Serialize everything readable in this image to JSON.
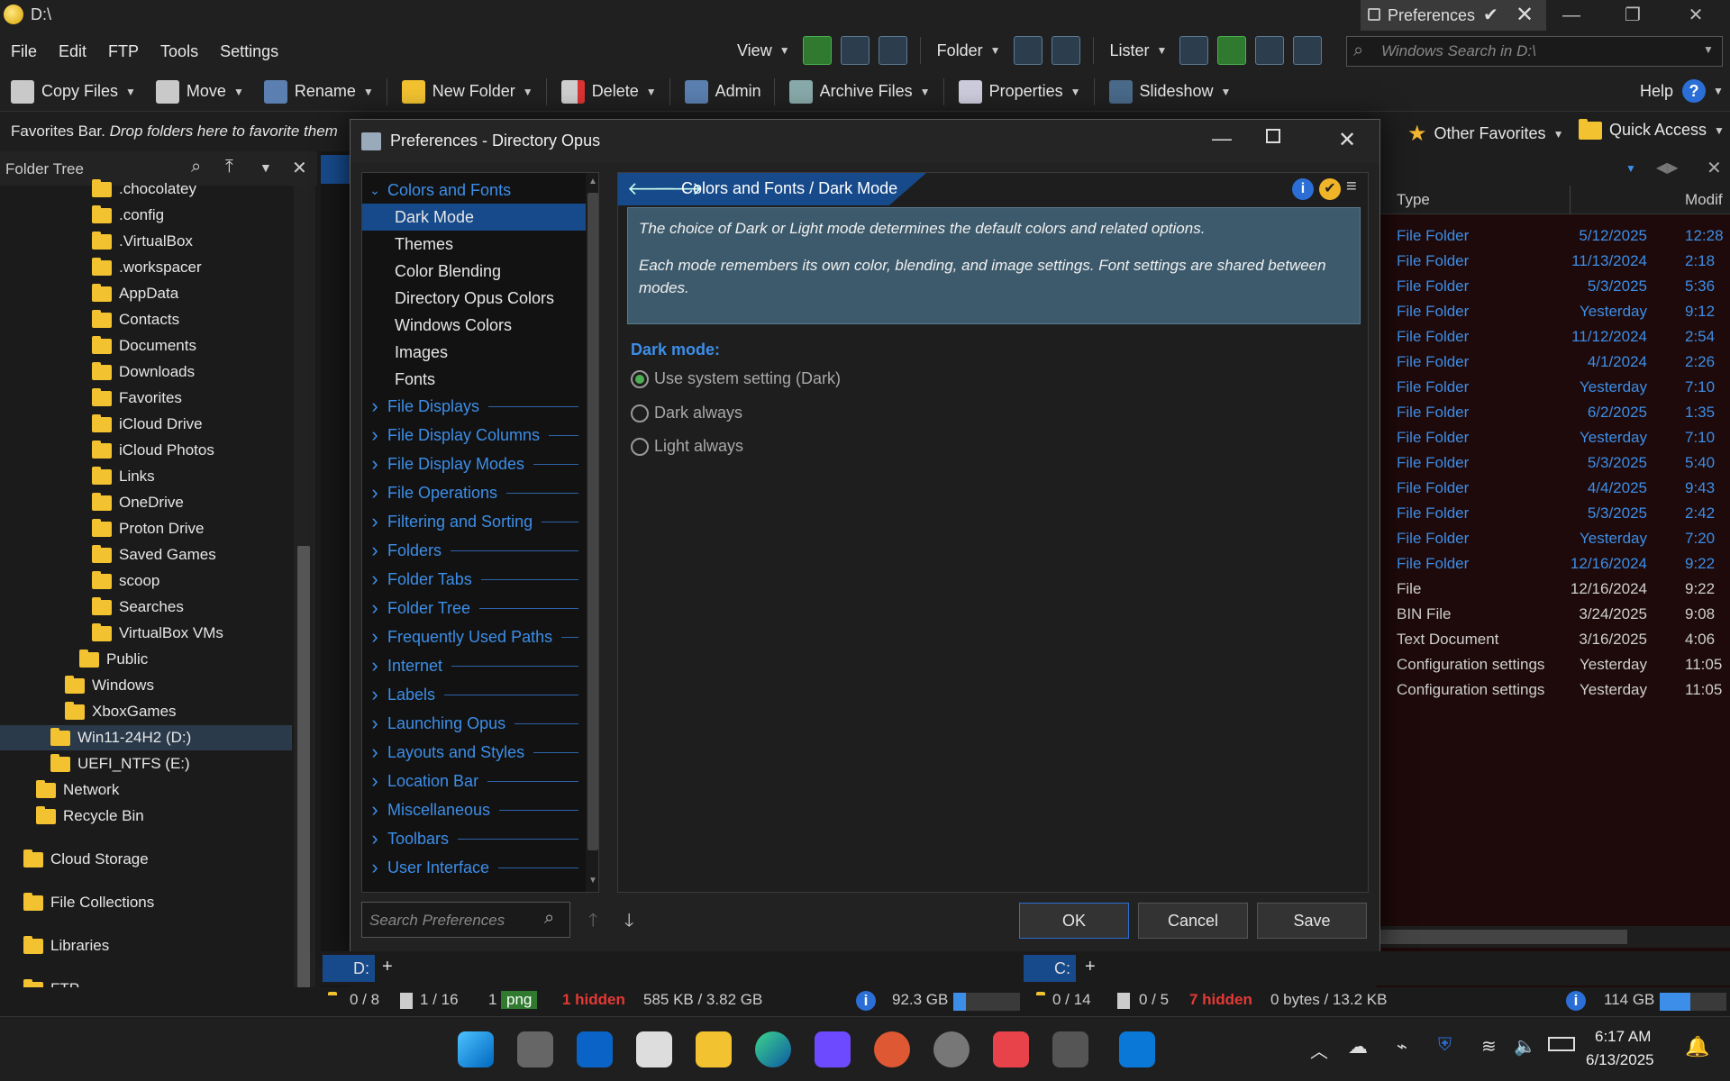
{
  "window": {
    "title": "D:\\",
    "prefs_tab": "Preferences"
  },
  "menu": {
    "items": [
      "File",
      "Edit",
      "FTP",
      "Tools",
      "Settings"
    ],
    "view": "View",
    "folder": "Folder",
    "lister": "Lister"
  },
  "search": {
    "placeholder": "Windows Search in D:\\"
  },
  "toolbar": {
    "copy": "Copy Files",
    "move": "Move",
    "rename": "Rename",
    "newfolder": "New Folder",
    "delete": "Delete",
    "admin": "Admin",
    "archive": "Archive Files",
    "properties": "Properties",
    "slideshow": "Slideshow",
    "help": "Help"
  },
  "favbar": {
    "bold": "Favorites Bar.",
    "italic": "Drop folders here to favorite them",
    "other": "Other Favorites",
    "quick": "Quick Access"
  },
  "foldertree": {
    "title": "Folder Tree",
    "items": [
      ".chocolatey",
      ".config",
      ".VirtualBox",
      ".workspacer",
      "AppData",
      "Contacts",
      "Documents",
      "Downloads",
      "Favorites",
      "iCloud Drive",
      "iCloud Photos",
      "Links",
      "OneDrive",
      "Proton Drive",
      "Saved Games",
      "scoop",
      "Searches",
      "VirtualBox VMs",
      "Public",
      "Windows",
      "XboxGames",
      "Win11-24H2 (D:)",
      "UEFI_NTFS (E:)",
      "Network",
      "Recycle Bin",
      "Cloud Storage",
      "File Collections",
      "Libraries",
      "FTP"
    ]
  },
  "filelist": {
    "col_type": "Type",
    "col_modified": "Modif",
    "rows": [
      {
        "type": "File Folder",
        "date": "5/12/2025",
        "time": "12:28"
      },
      {
        "type": "File Folder",
        "date": "11/13/2024",
        "time": "2:18"
      },
      {
        "type": "File Folder",
        "date": "5/3/2025",
        "time": "5:36"
      },
      {
        "type": "File Folder",
        "date": "Yesterday",
        "time": "9:12"
      },
      {
        "type": "File Folder",
        "date": "11/12/2024",
        "time": "2:54"
      },
      {
        "type": "File Folder",
        "date": "4/1/2024",
        "time": "2:26"
      },
      {
        "type": "File Folder",
        "date": "Yesterday",
        "time": "7:10"
      },
      {
        "type": "File Folder",
        "date": "6/2/2025",
        "time": "1:35"
      },
      {
        "type": "File Folder",
        "date": "Yesterday",
        "time": "7:10"
      },
      {
        "type": "File Folder",
        "date": "5/3/2025",
        "time": "5:40"
      },
      {
        "type": "File Folder",
        "date": "4/4/2025",
        "time": "9:43"
      },
      {
        "type": "File Folder",
        "date": "5/3/2025",
        "time": "2:42"
      },
      {
        "type": "File Folder",
        "date": "Yesterday",
        "time": "7:20"
      },
      {
        "type": "File Folder",
        "date": "12/16/2024",
        "time": "9:22"
      },
      {
        "type": "File",
        "date": "12/16/2024",
        "time": "9:22"
      },
      {
        "type": "BIN File",
        "date": "3/24/2025",
        "time": "9:08"
      },
      {
        "type": "Text Document",
        "date": "3/16/2025",
        "time": "4:06"
      },
      {
        "type": "Configuration settings",
        "date": "Yesterday",
        "time": "11:05"
      },
      {
        "type": "Configuration settings",
        "date": "Yesterday",
        "time": "11:05"
      }
    ]
  },
  "dialog": {
    "title": "Preferences - Directory Opus",
    "nav": [
      {
        "label": "Colors and Fonts",
        "kind": "open"
      },
      {
        "label": "Dark Mode",
        "kind": "sub",
        "selected": true
      },
      {
        "label": "Themes",
        "kind": "sub"
      },
      {
        "label": "Color Blending",
        "kind": "sub"
      },
      {
        "label": "Directory Opus Colors",
        "kind": "sub"
      },
      {
        "label": "Windows Colors",
        "kind": "sub"
      },
      {
        "label": "Images",
        "kind": "sub"
      },
      {
        "label": "Fonts",
        "kind": "sub"
      },
      {
        "label": "File Displays",
        "kind": "cat"
      },
      {
        "label": "File Display Columns",
        "kind": "cat"
      },
      {
        "label": "File Display Modes",
        "kind": "cat"
      },
      {
        "label": "File Operations",
        "kind": "cat"
      },
      {
        "label": "Filtering and Sorting",
        "kind": "cat"
      },
      {
        "label": "Folders",
        "kind": "cat"
      },
      {
        "label": "Folder Tabs",
        "kind": "cat"
      },
      {
        "label": "Folder Tree",
        "kind": "cat"
      },
      {
        "label": "Frequently Used Paths",
        "kind": "cat"
      },
      {
        "label": "Internet",
        "kind": "cat"
      },
      {
        "label": "Labels",
        "kind": "cat"
      },
      {
        "label": "Launching Opus",
        "kind": "cat"
      },
      {
        "label": "Layouts and Styles",
        "kind": "cat"
      },
      {
        "label": "Location Bar",
        "kind": "cat"
      },
      {
        "label": "Miscellaneous",
        "kind": "cat"
      },
      {
        "label": "Toolbars",
        "kind": "cat"
      },
      {
        "label": "User Interface",
        "kind": "cat"
      }
    ],
    "breadcrumb": "Colors and Fonts / Dark Mode",
    "info1": "The choice of Dark or Light mode determines the default colors and related options.",
    "info2": "Each mode remembers its own color, blending, and image settings. Font settings are shared between modes.",
    "section": "Dark mode:",
    "options": [
      "Use system setting (Dark)",
      "Dark always",
      "Light always"
    ],
    "selected_option": 0,
    "search_placeholder": "Search Preferences",
    "ok": "OK",
    "cancel": "Cancel",
    "save": "Save"
  },
  "status": {
    "left_tab": "D:",
    "right_tab": "C:",
    "l_folders": "0 / 8",
    "l_files": "1 / 16",
    "l_count": "1",
    "l_ext": "png",
    "l_hidden": "1 hidden",
    "l_size": "585 KB / 3.82 GB",
    "l_free": "92.3 GB",
    "r_folders": "0 / 14",
    "r_files": "0 / 5",
    "r_hidden": "7 hidden",
    "r_size": "0 bytes / 13.2 KB",
    "r_free": "114 GB"
  },
  "taskbar": {
    "time": "6:17 AM",
    "date": "6/13/2025"
  },
  "colors": {
    "accent": "#3d8ee8",
    "selection": "#174a8a",
    "info_bg": "#3d5a6c",
    "hidden_red": "#e53935"
  }
}
